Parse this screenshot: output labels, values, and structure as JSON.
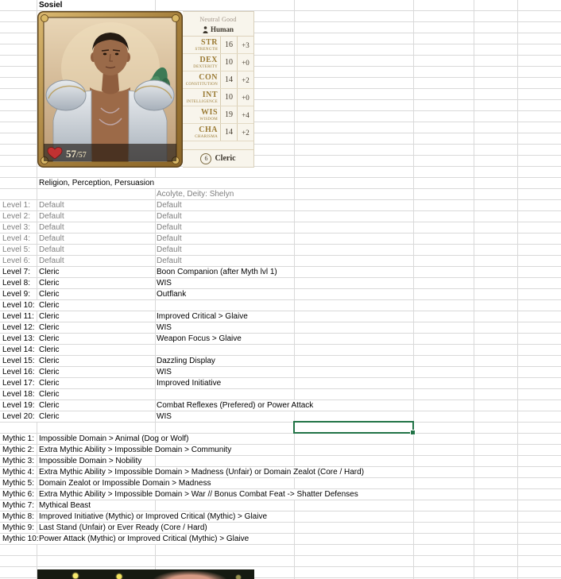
{
  "sheet": {
    "title": "Sosiel",
    "skills_row": "Religion, Perception, Persuasion",
    "background_row": "Acolyte, Deity: Shelyn",
    "levels": [
      {
        "label": "Level 1:",
        "class": "Default",
        "feat": "Default",
        "muted": true
      },
      {
        "label": "Level 2:",
        "class": "Default",
        "feat": "Default",
        "muted": true
      },
      {
        "label": "Level 3:",
        "class": "Default",
        "feat": "Default",
        "muted": true
      },
      {
        "label": "Level 4:",
        "class": "Default",
        "feat": "Default",
        "muted": true
      },
      {
        "label": "Level 5:",
        "class": "Default",
        "feat": "Default",
        "muted": true
      },
      {
        "label": "Level 6:",
        "class": "Default",
        "feat": "Default",
        "muted": true
      },
      {
        "label": "Level 7:",
        "class": "Cleric",
        "feat": "Boon Companion (after Myth lvl 1)",
        "muted": false
      },
      {
        "label": "Level 8:",
        "class": "Cleric",
        "feat": "WIS",
        "muted": false
      },
      {
        "label": "Level 9:",
        "class": "Cleric",
        "feat": "Outflank",
        "muted": false
      },
      {
        "label": "Level 10:",
        "class": "Cleric",
        "feat": "",
        "muted": false
      },
      {
        "label": "Level 11:",
        "class": "Cleric",
        "feat": "Improved Critical > Glaive",
        "muted": false
      },
      {
        "label": "Level 12:",
        "class": "Cleric",
        "feat": "WIS",
        "muted": false
      },
      {
        "label": "Level 13:",
        "class": "Cleric",
        "feat": "Weapon Focus > Glaive",
        "muted": false
      },
      {
        "label": "Level 14:",
        "class": "Cleric",
        "feat": "",
        "muted": false
      },
      {
        "label": "Level 15:",
        "class": "Cleric",
        "feat": "Dazzling Display",
        "muted": false
      },
      {
        "label": "Level 16:",
        "class": "Cleric",
        "feat": "WIS",
        "muted": false
      },
      {
        "label": "Level 17:",
        "class": "Cleric",
        "feat": "Improved Initiative",
        "muted": false
      },
      {
        "label": "Level 18:",
        "class": "Cleric",
        "feat": "",
        "muted": false
      },
      {
        "label": "Level 19:",
        "class": "Cleric",
        "feat": "Combat Reflexes (Prefered) or Power Attack",
        "muted": false
      },
      {
        "label": "Level 20:",
        "class": "Cleric",
        "feat": "WIS",
        "muted": false
      }
    ],
    "mythics": [
      {
        "label": "Mythic 1:",
        "text": "Impossible Domain > Animal (Dog or Wolf)"
      },
      {
        "label": "Mythic 2:",
        "text": "Extra Mythic Ability > Impossible Domain > Community"
      },
      {
        "label": "Mythic 3:",
        "text": "Impossible Domain > Nobility"
      },
      {
        "label": "Mythic 4:",
        "text": "Extra Mythic Ability > Impossible Domain > Madness (Unfair) or Domain Zealot (Core / Hard)"
      },
      {
        "label": "Mythic 5:",
        "text": "Domain Zealot or Impossible Domain > Madness"
      },
      {
        "label": "Mythic 6:",
        "text": "Extra Mythic Ability > Impossible Domain > War // Bonus Combat Feat -> Shatter Defenses"
      },
      {
        "label": "Mythic 7:",
        "text": "Mythical Beast"
      },
      {
        "label": "Mythic 8:",
        "text": "Improved Initiative (Mythic) or Improved Critical (Mythic) > Glaive"
      },
      {
        "label": "Mythic 9:",
        "text": "Last Stand (Unfair) or Ever Ready (Core / Hard)"
      },
      {
        "label": "Mythic 10:",
        "text": "Power Attack (Mythic) or Improved Critical (Mythic) > Glaive"
      }
    ]
  },
  "card": {
    "alignment": "Neutral Good",
    "race": "Human",
    "hp_current": "57",
    "hp_max_part": "/57",
    "abilities": [
      {
        "abbr": "STR",
        "name": "STRENGTH",
        "score": "16",
        "mod": "+3"
      },
      {
        "abbr": "DEX",
        "name": "DEXTERITY",
        "score": "10",
        "mod": "+0"
      },
      {
        "abbr": "CON",
        "name": "CONSTITUTION",
        "score": "14",
        "mod": "+2"
      },
      {
        "abbr": "INT",
        "name": "INTELLIGENCE",
        "score": "10",
        "mod": "+0"
      },
      {
        "abbr": "WIS",
        "name": "WISDOM",
        "score": "19",
        "mod": "+4"
      },
      {
        "abbr": "CHA",
        "name": "CHARISMA",
        "score": "14",
        "mod": "+2"
      }
    ],
    "class_level": "6",
    "class_name": "Cleric"
  },
  "colors": {
    "selection_green": "#217346",
    "gridline": "#d9d9d9",
    "muted_text": "#7f7f7f",
    "ability_label_gold": "#9a7a33",
    "hp_heart_red": "#c23232",
    "panel_parchment": "#f8f5ec",
    "frame_gold": "#c9a55f"
  }
}
